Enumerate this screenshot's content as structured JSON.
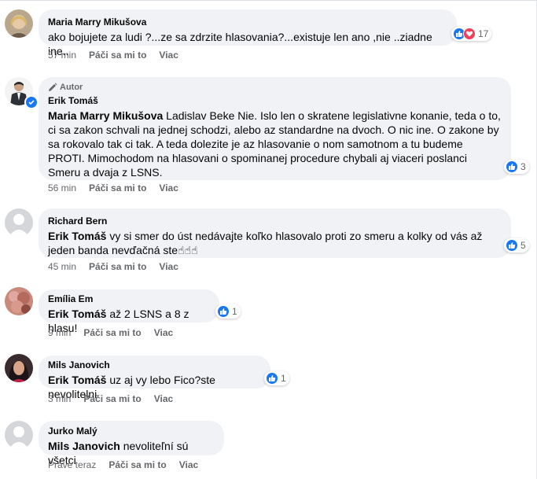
{
  "comments": [
    {
      "author": "Maria Marry Mikušova",
      "mention": "",
      "text": "ako bojujete za ludi ?...ze sa zdrzite hlasovania?...existuje len ano ,nie ..ziadne ine..",
      "time": "57 min",
      "like": "Páči sa mi to",
      "more": "Viac",
      "reactions": [
        "like-icon",
        "love-icon"
      ],
      "reaction_count": "17"
    },
    {
      "badge": "Autor",
      "author": "Erik Tomáš",
      "mention": "Maria Marry Mikušova",
      "text": " Ladislav Beke Nie. Islo len o skratene legislativne konanie, teda o to, ci sa zakon schvali na jednej schodzi, alebo az standardne na dvoch. O nic ine. O zakone by sa rokovalo tak ci tak. A teda dolezite je az hlasovanie o nom samotnom a tu budeme PROTI. Mimochodom na hlasovani o spominanej procedure chybali aj viaceri poslanci Smeru a dvaja z LSNS.",
      "time": "56 min",
      "like": "Páči sa mi to",
      "more": "Viac",
      "reactions": [
        "like-icon"
      ],
      "reaction_count": "3"
    },
    {
      "author": "Richard Bern",
      "mention": "Erik Tomáš",
      "text": " vy si smer do úst nedávajte koľko hlasovalo proti zo smeru a kolky od vás až jeden banda nevďačná ste☝☝☝",
      "time": "45 min",
      "like": "Páči sa mi to",
      "more": "Viac",
      "reactions": [
        "like-icon"
      ],
      "reaction_count": "5"
    },
    {
      "author": "Emília Em",
      "mention": "Erik Tomáš",
      "text": " až 2 LSNS a 8 z hlasu!",
      "time": "9 min",
      "like": "Páči sa mi to",
      "more": "Viac",
      "reactions": [
        "like-icon"
      ],
      "reaction_count": "1"
    },
    {
      "author": "Mils Janovich",
      "mention": "Erik Tomáš",
      "text": " uz aj vy lebo Fico?ste nevolitelni",
      "time": "3 min",
      "like": "Páči sa mi to",
      "more": "Viac",
      "reactions": [
        "like-icon"
      ],
      "reaction_count": "1"
    },
    {
      "author": "Jurko Malý",
      "mention": "Mils Janovich",
      "text": " nevoliteľní sú všetci",
      "time": "Práve teraz",
      "like": "Páči sa mi to",
      "more": "Viac",
      "reactions": [],
      "reaction_count": ""
    }
  ],
  "colors": {
    "bubble": "#f0f2f5",
    "meta": "#65676b",
    "like": "#1877f2",
    "love": "#f33e58"
  }
}
